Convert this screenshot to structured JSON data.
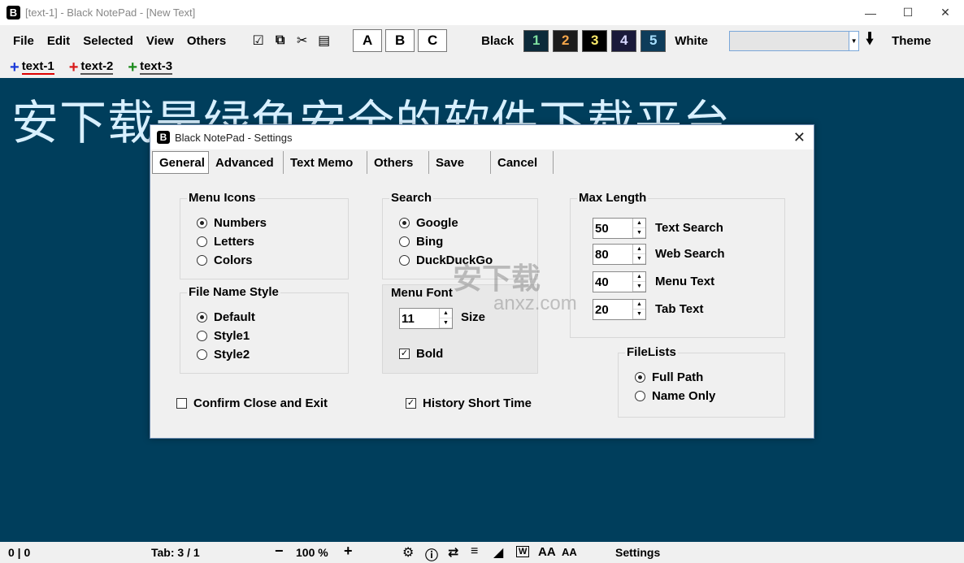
{
  "window": {
    "title": "[text-1] - Black NotePad - [New Text]",
    "logo": "B",
    "controls": [
      "minimize-icon",
      "maximize-icon",
      "close-icon"
    ]
  },
  "menu": {
    "items": [
      "File",
      "Edit",
      "Selected",
      "View",
      "Others"
    ],
    "abc": [
      "A",
      "B",
      "C"
    ],
    "theme_left": "Black",
    "theme_right": "White",
    "theme_numbers": [
      {
        "label": "1",
        "bg": "#0c2a3a",
        "fg": "#7ee0a0"
      },
      {
        "label": "2",
        "bg": "#1c1c1c",
        "fg": "#f5a64a"
      },
      {
        "label": "3",
        "bg": "#000000",
        "fg": "#f8e86a"
      },
      {
        "label": "4",
        "bg": "#1a1a3a",
        "fg": "#d8d8ff"
      },
      {
        "label": "5",
        "bg": "#0e3c5a",
        "fg": "#a8e0ff"
      }
    ],
    "theme_label": "Theme",
    "combo_value": ""
  },
  "tabs": [
    {
      "label": "text-1",
      "color": "#1a3ad8"
    },
    {
      "label": "text-2",
      "color": "#d81a1a"
    },
    {
      "label": "text-3",
      "color": "#1a8a1a"
    }
  ],
  "editor": {
    "text": "安下载是绿色安全的软件下载平台。",
    "bg": "#003e5c"
  },
  "status": {
    "position": "0 | 0",
    "tab": "Tab: 3 / 1",
    "zoom_minus": "−",
    "zoom": "100 %",
    "zoom_plus": "+",
    "settings": "Settings",
    "wrap_icon_letter": "W",
    "font_up_label": "AA",
    "font_down_label": "AA"
  },
  "dialog": {
    "logo": "B",
    "title": "Black NotePad - Settings",
    "tabs": [
      "General",
      "Advanced",
      "Text Memo",
      "Others",
      "Save",
      "Cancel"
    ],
    "menu_icons": {
      "title": "Menu Icons",
      "options": [
        "Numbers",
        "Letters",
        "Colors"
      ],
      "selected": 0
    },
    "file_name_style": {
      "title": "File Name Style",
      "options": [
        "Default",
        "Style1",
        "Style2"
      ],
      "selected": 0
    },
    "search": {
      "title": "Search",
      "options": [
        "Google",
        "Bing",
        "DuckDuckGo"
      ],
      "selected": 0
    },
    "menu_font": {
      "title": "Menu Font",
      "size_value": "11",
      "size_label": "Size",
      "bold_label": "Bold",
      "bold_checked": true
    },
    "max_length": {
      "title": "Max Length",
      "fields": [
        {
          "value": "50",
          "label": "Text Search"
        },
        {
          "value": "80",
          "label": "Web Search"
        },
        {
          "value": "40",
          "label": "Menu Text"
        },
        {
          "value": "20",
          "label": "Tab Text"
        }
      ]
    },
    "file_lists": {
      "title": "FileLists",
      "options": [
        "Full Path",
        "Name Only"
      ],
      "selected": 0
    },
    "confirm_close": {
      "label": "Confirm Close and Exit",
      "checked": false
    },
    "history_short": {
      "label": "History Short Time",
      "checked": true
    },
    "watermark": "安下载",
    "watermark_sub": "anxz.com"
  }
}
